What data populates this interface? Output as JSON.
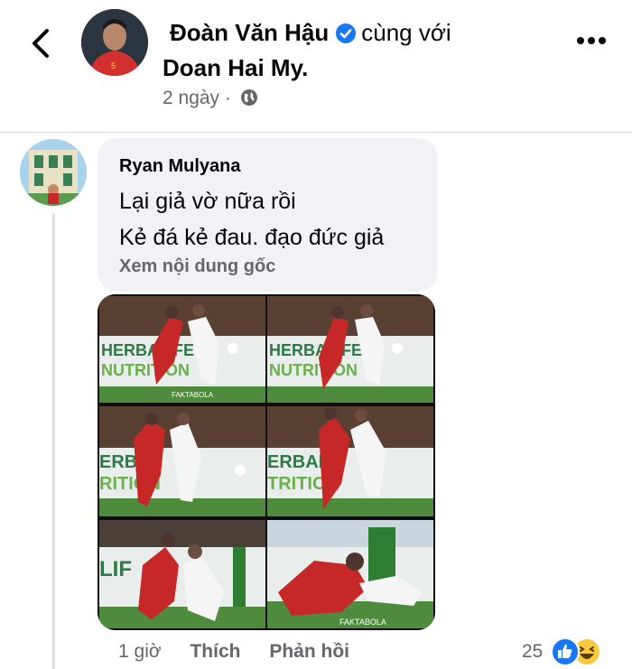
{
  "header": {
    "author_name": "Đoàn Văn Hậu",
    "with_text": "cùng với",
    "tagged_name": "Doan Hai My.",
    "timestamp": "2 ngày",
    "separator": "·",
    "icons": {
      "back": "back-arrow-icon",
      "verified": "verified-badge-icon",
      "privacy": "globe-icon",
      "more": "more-options-icon"
    }
  },
  "comment": {
    "author": "Ryan Mulyana",
    "lines": [
      "Lại giả vờ nữa rồi",
      "Kẻ đá kẻ đau. đạo đức giả"
    ],
    "see_original": "Xem nội dung gốc",
    "photo": {
      "panel_texts": [
        "HERBALIFE",
        "NUTRITION",
        "HERBALIFE",
        "NUTRITION",
        "ERBAL",
        "RITION",
        "ERBAL",
        "TRITION",
        "LIF",
        "FAKTABOLA"
      ],
      "watermark": "FAKTABOLA"
    },
    "time": "1 giờ",
    "like": "Thích",
    "reply": "Phản hồi",
    "reaction_count": "25",
    "reaction_icons": [
      "like-reaction-icon",
      "haha-reaction-icon"
    ],
    "colors": {
      "like": "#1877f2",
      "haha": "#f7c840",
      "bubble": "#f0f2f5",
      "meta": "#65676b"
    }
  }
}
